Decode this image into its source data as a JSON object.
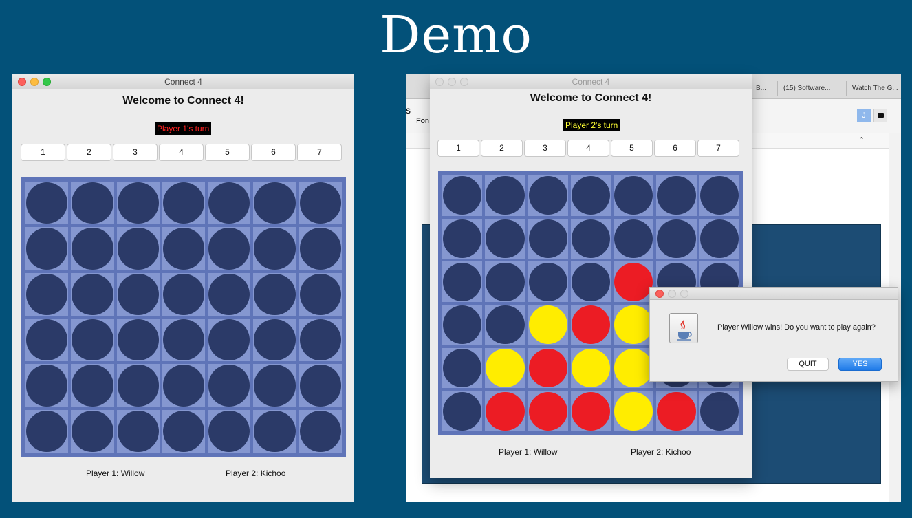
{
  "slide": {
    "title": "Demo"
  },
  "left_window": {
    "title": "Connect 4",
    "welcome": "Welcome to Connect 4!",
    "turn_text": "Player 1's turn",
    "turn_color": "#ff2222",
    "columns": [
      "1",
      "2",
      "3",
      "4",
      "5",
      "6",
      "7"
    ],
    "player1_label": "Player 1: Willow",
    "player2_label": "Player 2: Kichoo",
    "board": [
      [
        "E",
        "E",
        "E",
        "E",
        "E",
        "E",
        "E"
      ],
      [
        "E",
        "E",
        "E",
        "E",
        "E",
        "E",
        "E"
      ],
      [
        "E",
        "E",
        "E",
        "E",
        "E",
        "E",
        "E"
      ],
      [
        "E",
        "E",
        "E",
        "E",
        "E",
        "E",
        "E"
      ],
      [
        "E",
        "E",
        "E",
        "E",
        "E",
        "E",
        "E"
      ],
      [
        "E",
        "E",
        "E",
        "E",
        "E",
        "E",
        "E"
      ]
    ]
  },
  "right_window": {
    "title": "Connect 4",
    "welcome": "Welcome to Connect 4!",
    "turn_text": "Player 2's turn",
    "turn_color": "#ffff33",
    "columns": [
      "1",
      "2",
      "3",
      "4",
      "5",
      "6",
      "7"
    ],
    "player1_label": "Player 1: Willow",
    "player2_label": "Player 2: Kichoo",
    "board": [
      [
        "E",
        "E",
        "E",
        "E",
        "E",
        "E",
        "E"
      ],
      [
        "E",
        "E",
        "E",
        "E",
        "E",
        "E",
        "E"
      ],
      [
        "E",
        "E",
        "E",
        "E",
        "R",
        "E",
        "E"
      ],
      [
        "E",
        "E",
        "Y",
        "R",
        "Y",
        "E",
        "E"
      ],
      [
        "E",
        "Y",
        "R",
        "Y",
        "Y",
        "E",
        "E"
      ],
      [
        "E",
        "R",
        "R",
        "R",
        "Y",
        "R",
        "E"
      ]
    ]
  },
  "browser": {
    "tabs": [
      "B...",
      "(15) Software...",
      "Watch The G..."
    ],
    "fragment_1": "s",
    "fragment_2": "Fon",
    "avatar_letter": "J"
  },
  "dialog": {
    "message": "Player Willow wins! Do you want to play again?",
    "quit_label": "QUIT",
    "yes_label": "YES"
  },
  "colors": {
    "background": "#035179",
    "empty_disc": "#2b3a68",
    "red_disc": "#ec1c24",
    "yellow_disc": "#ffed00",
    "board": "#5f74b8",
    "cell": "#8597d0",
    "dialog_yes": "#2d86f3"
  },
  "icons": [
    "java-cup-icon",
    "chat-bubble-icon",
    "chevron-up-icon"
  ]
}
